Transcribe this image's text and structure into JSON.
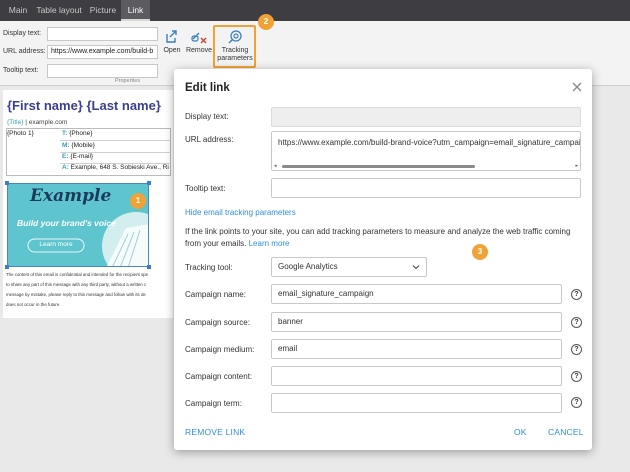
{
  "tabs": [
    {
      "label": "Main",
      "active": false
    },
    {
      "label": "Table layout",
      "active": false
    },
    {
      "label": "Picture",
      "active": false
    },
    {
      "label": "Link",
      "active": true
    }
  ],
  "ribbon": {
    "display_text_label": "Display text:",
    "display_text_value": "",
    "url_label": "URL address:",
    "url_value": "https://www.example.com/build-b",
    "tooltip_label": "Tooltip text:",
    "tooltip_value": "",
    "open_label": "Open",
    "remove_label": "Remove",
    "tracking_label_1": "Tracking",
    "tracking_label_2": "parameters",
    "group_label": "Properties"
  },
  "callouts": {
    "one": "1",
    "two": "2",
    "three": "3"
  },
  "signature": {
    "name": "{First name} {Last name}",
    "title": "{Title}",
    "separator": " | ",
    "website": "example.com",
    "photo": "{Photo 1}",
    "rows": [
      {
        "key": "T:",
        "value": "{Phone}"
      },
      {
        "key": "M:",
        "value": "{Mobile}"
      },
      {
        "key": "E:",
        "value": "{E-mail}"
      },
      {
        "key": "A:",
        "value": "Example, 648 S. Sobieski Ave., Ri"
      }
    ],
    "banner_brand": "Example",
    "banner_tagline": "Build your brand's voice",
    "banner_button": "Learn more",
    "disclaimer": [
      "The content of this email is confidential and intended for the recipient spe",
      "to share any part of this message with any third party, without a written c",
      "message by mistake, please reply to this message and follow with its de",
      "does not occur in the future."
    ]
  },
  "dialog": {
    "title": "Edit link",
    "display_text_label": "Display text:",
    "display_text_value": "",
    "url_label": "URL address:",
    "url_value": "https://www.example.com/build-brand-voice?utm_campaign=email_signature_campaign",
    "tooltip_label": "Tooltip text:",
    "tooltip_value": "",
    "hide_tracking_link": "Hide email tracking parameters",
    "info_text": "If the link points to your site, you can add tracking parameters to measure and analyze the web traffic coming from your emails.",
    "learn_more": "Learn more",
    "tracking_tool_label": "Tracking tool:",
    "tracking_tool_value": "Google Analytics",
    "params": [
      {
        "label": "Campaign name:",
        "value": "email_signature_campaign"
      },
      {
        "label": "Campaign source:",
        "value": "banner"
      },
      {
        "label": "Campaign medium:",
        "value": "email"
      },
      {
        "label": "Campaign content:",
        "value": ""
      },
      {
        "label": "Campaign term:",
        "value": ""
      }
    ],
    "help_glyph": "?",
    "remove_link": "REMOVE LINK",
    "ok": "OK",
    "cancel": "CANCEL"
  },
  "colors": {
    "accent": "#2f8fd8",
    "highlight": "#f0a236",
    "brand_text": "#3b3f8f"
  }
}
